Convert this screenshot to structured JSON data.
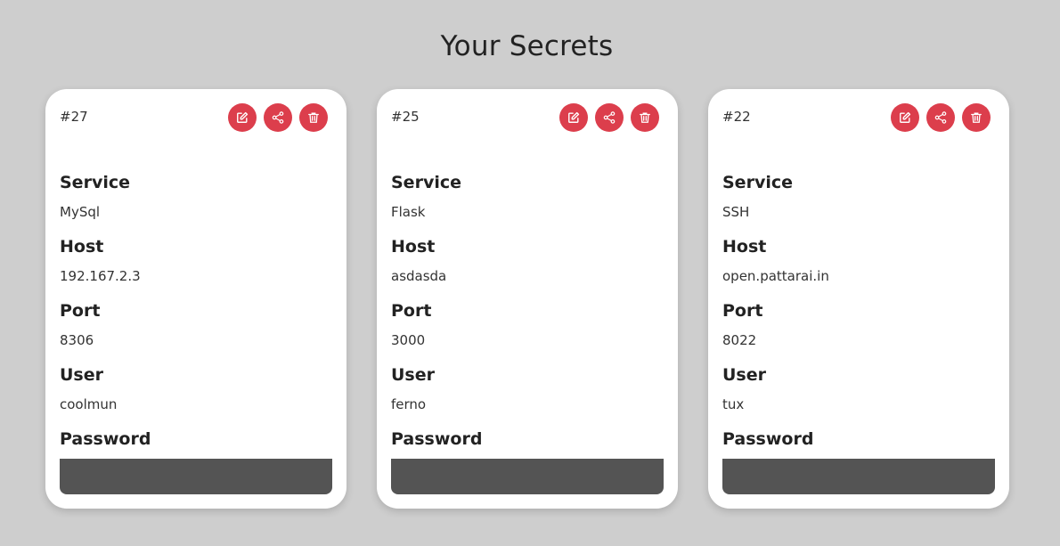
{
  "page": {
    "title": "Your Secrets"
  },
  "labels": {
    "service": "Service",
    "host": "Host",
    "port": "Port",
    "user": "User",
    "password": "Password"
  },
  "icons": {
    "edit": "edit-icon",
    "share": "share-icon",
    "delete": "trash-icon"
  },
  "colors": {
    "background": "#cecece",
    "card": "#ffffff",
    "action_button": "#dc3e4c",
    "password_mask": "#545454"
  },
  "secrets": [
    {
      "id": "#27",
      "service": "MySql",
      "host": "192.167.2.3",
      "port": "8306",
      "user": "coolmun"
    },
    {
      "id": "#25",
      "service": "Flask",
      "host": "asdasda",
      "port": "3000",
      "user": "ferno"
    },
    {
      "id": "#22",
      "service": "SSH",
      "host": "open.pattarai.in",
      "port": "8022",
      "user": "tux"
    }
  ]
}
